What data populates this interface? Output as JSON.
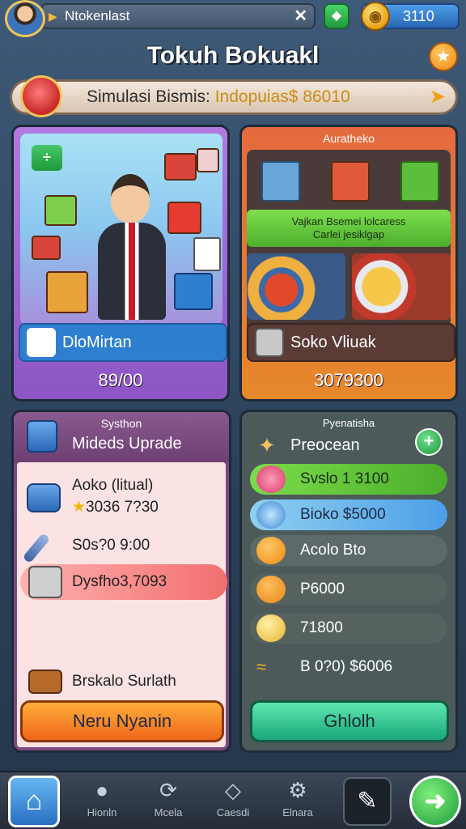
{
  "top": {
    "player_name": "Ntokenlast",
    "lead_icon": "play-arrow-icon",
    "close_icon": "close-icon",
    "gem_icon": "diamond-icon",
    "coin_value": "3110",
    "coin_icon": "coin-icon"
  },
  "title": "Tokuh Bokuakl",
  "sim_bar": {
    "label": "Simulasi Bismis:",
    "value": "Indopuias$ 86010"
  },
  "panel_left": {
    "label": "DloMirtan",
    "value": "89/00"
  },
  "panel_right": {
    "heading": "Auratheko",
    "banner_line1": "Vajkan Bsemei lolcaress",
    "banner_line2": "Carlei jesiklgap",
    "label": "Soko Vliuak",
    "value": "3079300"
  },
  "panel_upgrade": {
    "heading": "Systhon",
    "title": "Mideds Uprade",
    "items": [
      {
        "line1": "Aoko (litual)",
        "line2": "3036 7?30"
      },
      {
        "line1": "S0s?0 9:00"
      },
      {
        "line1": "Dysfho3,7093"
      },
      {
        "line1": "Brskalo Surlath"
      }
    ],
    "button": "Neru Nyanin"
  },
  "panel_economy": {
    "heading": "Pyenatisha",
    "title": "Preocean",
    "rows": [
      "Svslo 1 3100",
      "Bioko $5000",
      "Acolo Bto",
      "P6000",
      "71800",
      "B 0?0) $6006"
    ],
    "button": "Ghlolh"
  },
  "nav": [
    {
      "label": "Hionln",
      "icon": "person-icon"
    },
    {
      "label": "Mcela",
      "icon": "refresh-icon"
    },
    {
      "label": "Caesdi",
      "icon": "diamond-outline-icon"
    },
    {
      "label": "Elnara",
      "icon": "gear-icon"
    }
  ],
  "colors": {
    "background": "#2b4058",
    "purple": "#8d55c4",
    "orange": "#e6882b",
    "green": "#1f9a3b",
    "blue": "#2f7fd0",
    "gold": "#f0c35a"
  }
}
